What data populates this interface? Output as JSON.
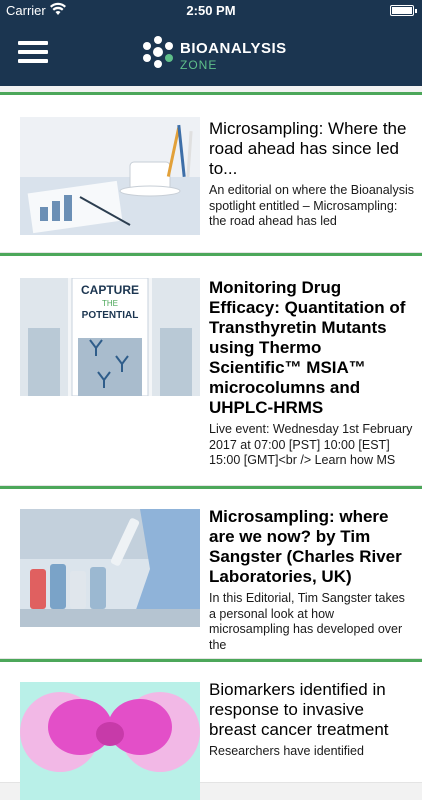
{
  "status_bar": {
    "carrier": "Carrier",
    "time": "2:50 PM"
  },
  "nav": {
    "logo_line1": "BIOANALYSIS",
    "logo_line2": "ZONE",
    "menu_icon": "hamburger-menu-icon"
  },
  "articles": [
    {
      "title": "Microsampling: Where the road ahead has since led to...",
      "excerpt": "An editorial on where the Bioanalysis spotlight entitled – Microsampling: the road ahead has led",
      "bold": false
    },
    {
      "title": "Monitoring Drug Efficacy: Quantitation of Transthyretin Mutants using Thermo Scientific™ MSIA™ microcolumns and UHPLC-HRMS",
      "excerpt": "Live event: Wednesday 1st February 2017 at 07:00 [PST] 10:00 [EST] 15:00 [GMT]<br /> Learn how MS",
      "bold": true,
      "thumb_text_1": "CAPTURE",
      "thumb_text_2": "THE",
      "thumb_text_3": "POTENTIAL"
    },
    {
      "title": "Microsampling: where are we now? by Tim Sangster (Charles River Laboratories, UK)",
      "excerpt": "In this Editorial, Tim Sangster takes a personal look at how microsampling has developed over the",
      "bold": true
    },
    {
      "title": "Biomarkers identified in response to invasive breast cancer treatment",
      "excerpt": "Researchers have identified",
      "bold": false
    }
  ],
  "colors": {
    "nav_background": "#1b3550",
    "divider": "#4ca75a"
  }
}
